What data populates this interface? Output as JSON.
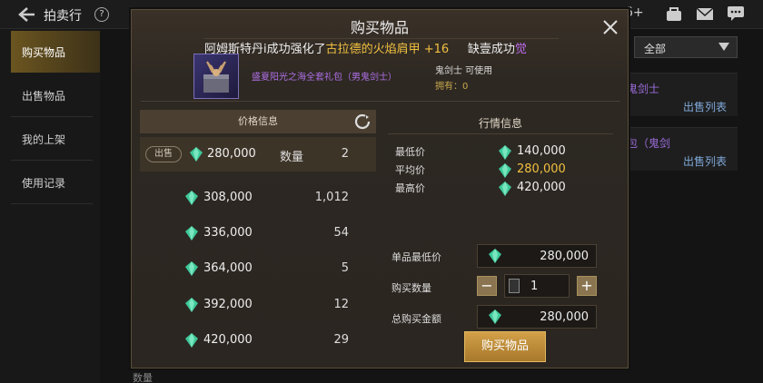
{
  "topbar": {
    "title": "拍卖行",
    "help": "?",
    "extra": "6+"
  },
  "sidebar": {
    "items": [
      {
        "label": "购买物品",
        "active": true
      },
      {
        "label": "出售物品"
      },
      {
        "label": "我的上架"
      },
      {
        "label": "使用记录"
      }
    ]
  },
  "background": {
    "filter": "全部",
    "cards": [
      {
        "cls": "鬼剑士",
        "btn": "出售列表"
      },
      {
        "cls": "包（鬼剑",
        "btn": "出售列表"
      }
    ],
    "bottom": "数量"
  },
  "modal": {
    "title": "购买物品",
    "notice": {
      "prefix": "阿姆斯特丹i成功强化了",
      "item": "古拉德的火焰肩甲 +16",
      "suffix": "缺壹成功",
      "tail": "觉"
    },
    "item": {
      "name": "盛夏阳光之海全套礼包（男鬼剑士）",
      "class": "鬼剑士 可使用",
      "owned": "拥有：0"
    },
    "price_panel": {
      "header": "价格信息",
      "sell_tag": "出售",
      "qty_label": "数量",
      "rows": [
        {
          "price": "280,000",
          "qty": "2"
        },
        {
          "price": "308,000",
          "qty": "1,012"
        },
        {
          "price": "336,000",
          "qty": "54"
        },
        {
          "price": "364,000",
          "qty": "5"
        },
        {
          "price": "392,000",
          "qty": "12"
        },
        {
          "price": "420,000",
          "qty": "29"
        }
      ]
    },
    "market": {
      "title": "行情信息",
      "lowest_label": "最低价",
      "lowest": "140,000",
      "avg_label": "平均价",
      "avg": "280,000",
      "highest_label": "最高价",
      "highest": "420,000"
    },
    "form": {
      "unit_label": "单品最低价",
      "unit_value": "280,000",
      "qty_label": "购买数量",
      "qty_value": "1",
      "total_label": "总购买金额",
      "total_value": "280,000"
    },
    "buy_label": "购买物品"
  }
}
